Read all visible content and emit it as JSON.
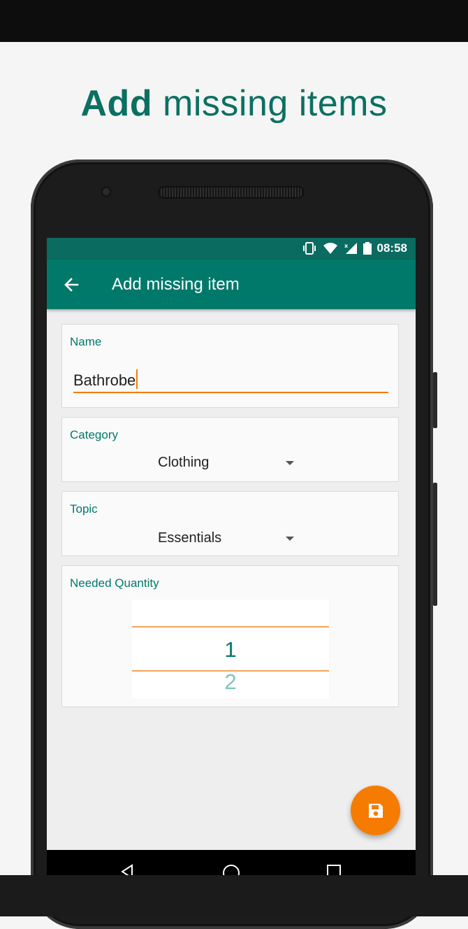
{
  "headline": {
    "bold": "Add",
    "rest": " missing items"
  },
  "status_bar": {
    "time": "08:58"
  },
  "app_bar": {
    "title": "Add missing item"
  },
  "form": {
    "name": {
      "label": "Name",
      "value": "Bathrobe"
    },
    "category": {
      "label": "Category",
      "value": "Clothing"
    },
    "topic": {
      "label": "Topic",
      "value": "Essentials"
    },
    "quantity": {
      "label": "Needed Quantity",
      "selected": "1",
      "next": "2"
    }
  },
  "colors": {
    "primary": "#00796b",
    "primary_dark": "#0a6b60",
    "accent": "#f57c00"
  },
  "icons": [
    "vibrate-icon",
    "wifi-icon",
    "signal-icon",
    "battery-icon",
    "back-arrow-icon",
    "save-icon",
    "nav-back-icon",
    "nav-home-icon",
    "nav-recents-icon"
  ]
}
